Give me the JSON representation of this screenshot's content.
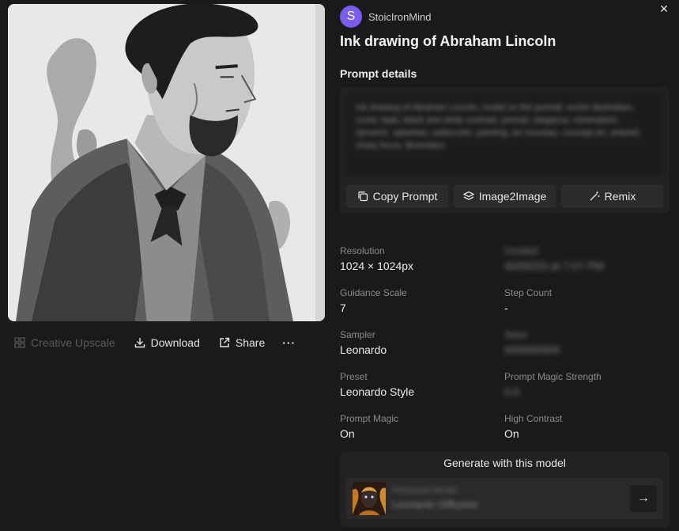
{
  "header": {
    "username": "StoicIronMind",
    "avatar_letter": "S",
    "title": "Ink drawing of Abraham Lincoln",
    "close_glyph": "✕"
  },
  "image": {
    "alt": "Ink drawing of Abraham Lincoln"
  },
  "image_actions": {
    "upscale_label": "Creative Upscale",
    "download_label": "Download",
    "share_label": "Share",
    "more_label": "···"
  },
  "prompt": {
    "section_title": "Prompt details",
    "text": "Ink drawing of Abraham Lincoln, model on the portrait, vector illustration, comic style, black and white contrast, portrait, elegance, minimalism, dynamic, splashes, watercolor, painting, art nouveau, concept art, artwork, sharp focus, illustration",
    "copy_label": "Copy Prompt",
    "image2image_label": "Image2Image",
    "remix_label": "Remix"
  },
  "metadata": [
    {
      "label": "Resolution",
      "value": "1024 × 1024px",
      "blurred": false
    },
    {
      "label": "Created",
      "value": "00/00/23 at 7:07 PM",
      "blurred": true
    },
    {
      "label": "Guidance Scale",
      "value": "7",
      "blurred": false
    },
    {
      "label": "Step Count",
      "value": "-",
      "blurred": false
    },
    {
      "label": "Sampler",
      "value": "Leonardo",
      "blurred": false
    },
    {
      "label": "Seed",
      "value": "000000000",
      "blurred": true
    },
    {
      "label": "Preset",
      "value": "Leonardo Style",
      "blurred": false
    },
    {
      "label": "Prompt Magic Strength",
      "value": "0.0",
      "blurred": true
    },
    {
      "label": "Prompt Magic",
      "value": "On",
      "blurred": false
    },
    {
      "label": "High Contrast",
      "value": "On",
      "blurred": false
    }
  ],
  "model": {
    "section_title": "Generate with this model",
    "name": "Finetuned Model",
    "subtitle": "Leonardo Diffusion",
    "go_glyph": "→"
  },
  "colors": {
    "background": "#1a1a1a",
    "panel": "#222222",
    "avatar": "#7b5cf0"
  }
}
